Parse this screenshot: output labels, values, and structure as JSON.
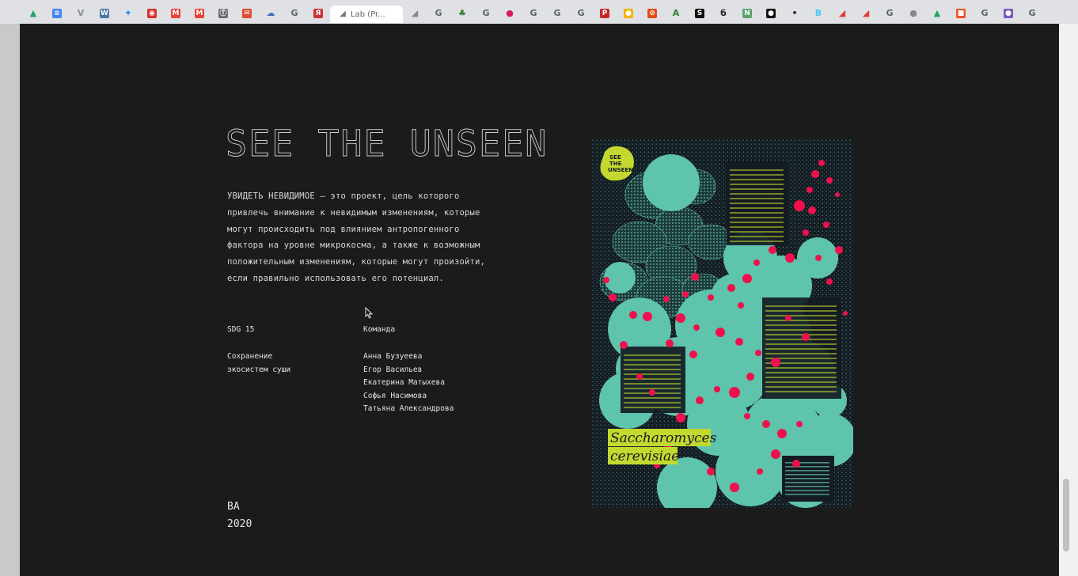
{
  "browser": {
    "active_tab_title": "Lab (Pr...",
    "tabs": [
      {
        "icon": "drive-icon",
        "glyph": "▲",
        "color": "#1fa463"
      },
      {
        "icon": "docs-icon",
        "glyph": "≡",
        "color": "#4285f4"
      },
      {
        "icon": "vk-icon",
        "glyph": "V",
        "color": "#8a8f99"
      },
      {
        "icon": "vk-blue-icon",
        "glyph": "W",
        "color": "#4a76a8"
      },
      {
        "icon": "butterfly-icon",
        "glyph": "✦",
        "color": "#1185fe"
      },
      {
        "icon": "red-circle-icon",
        "glyph": "◉",
        "color": "#d93025"
      },
      {
        "icon": "gmail-icon",
        "glyph": "M",
        "color": "#ea4335"
      },
      {
        "icon": "gmail-icon-2",
        "glyph": "M",
        "color": "#ea4335"
      },
      {
        "icon": "t-circle-icon",
        "glyph": "Ⓣ",
        "color": "#6d6d6d"
      },
      {
        "icon": "mail-icon",
        "glyph": "✉",
        "color": "#e04b33"
      },
      {
        "icon": "cloud-icon",
        "glyph": "☁",
        "color": "#3f6fb6"
      },
      {
        "icon": "google-icon",
        "glyph": "G",
        "color": "g"
      },
      {
        "icon": "yandex-icon",
        "glyph": "Я",
        "color": "#cc3333"
      },
      {
        "icon": "active",
        "glyph": "◢",
        "color": "#777777"
      },
      {
        "icon": "lab-icon",
        "glyph": "◢",
        "color": "#888888"
      },
      {
        "icon": "google-icon",
        "glyph": "G",
        "color": "g"
      },
      {
        "icon": "tree-icon",
        "glyph": "♣",
        "color": "#2e7d32"
      },
      {
        "icon": "google-icon",
        "glyph": "G",
        "color": "g"
      },
      {
        "icon": "red-bear-icon",
        "glyph": "●",
        "color": "#d81b60"
      },
      {
        "icon": "google-icon",
        "glyph": "G",
        "color": "g"
      },
      {
        "icon": "google-icon",
        "glyph": "G",
        "color": "g"
      },
      {
        "icon": "google-icon",
        "glyph": "G",
        "color": "g"
      },
      {
        "icon": "p-icon",
        "glyph": "P",
        "color": "#c62828"
      },
      {
        "icon": "yellow-circle-icon",
        "glyph": "●",
        "color": "#f4b400"
      },
      {
        "icon": "strike-circle-icon",
        "glyph": "⊘",
        "color": "#e64a19"
      },
      {
        "icon": "a-icon",
        "glyph": "A",
        "color": "#2e7d32"
      },
      {
        "icon": "s-icon",
        "glyph": "S",
        "color": "#111111"
      },
      {
        "icon": "six-icon",
        "glyph": "б",
        "color": "#222222"
      },
      {
        "icon": "green-square-icon",
        "glyph": "N",
        "color": "#5aa469"
      },
      {
        "icon": "black-circle-icon",
        "glyph": "●",
        "color": "#111111"
      },
      {
        "icon": "dot-icon",
        "glyph": "•",
        "color": "#222222"
      },
      {
        "icon": "blue-b-icon",
        "glyph": "B",
        "color": "#4fc3f7"
      },
      {
        "icon": "red-pen-icon",
        "glyph": "◢",
        "color": "#e53935"
      },
      {
        "icon": "red-pen-icon-2",
        "glyph": "◢",
        "color": "#e53935"
      },
      {
        "icon": "google-icon",
        "glyph": "G",
        "color": "g"
      },
      {
        "icon": "apple-icon",
        "glyph": "●",
        "color": "#888888"
      },
      {
        "icon": "drive-icon",
        "glyph": "▲",
        "color": "#1fa463"
      },
      {
        "icon": "ms-icon",
        "glyph": "■",
        "color": "#f25022"
      },
      {
        "icon": "google-icon",
        "glyph": "G",
        "color": "g"
      },
      {
        "icon": "purple-circle-icon",
        "glyph": "●",
        "color": "#7e57c2"
      },
      {
        "icon": "google-icon",
        "glyph": "G",
        "color": "g"
      }
    ]
  },
  "project": {
    "title": "SEE THE UNSEEN",
    "description": "УВИДЕТЬ НЕВИДИМОЕ – это проект, цель которого привлечь внимание к невидимым изменениям, которые могут происходить под влиянием антропогенного фактора на уровне микрокосма, а также к возможным положительным изменениям, которые могут произойти, если правильно использовать его потенциал.",
    "sdg_label": "SDG 15",
    "sdg_description": "Сохранение экосистем суши",
    "team_label": "Команда",
    "team": [
      "Анна Бузуеева",
      "Егор Васильев",
      "Екатерина Матыхева",
      "Софья Насимова",
      "Татьяна Александрова"
    ],
    "degree": "BA",
    "year": "2020"
  },
  "poster": {
    "badge": [
      "SEE",
      "THE",
      "UNSEEN"
    ],
    "species_line1": "Saccharomyces",
    "species_line2": "cerevisiae",
    "colors": {
      "background": "#151b22",
      "cells": "#5fc4ac",
      "dots": "#f0104d",
      "accent": "#c3d92f"
    }
  },
  "colors": {
    "page_background": "#1b1b1c",
    "text": "#d8d8d8"
  }
}
